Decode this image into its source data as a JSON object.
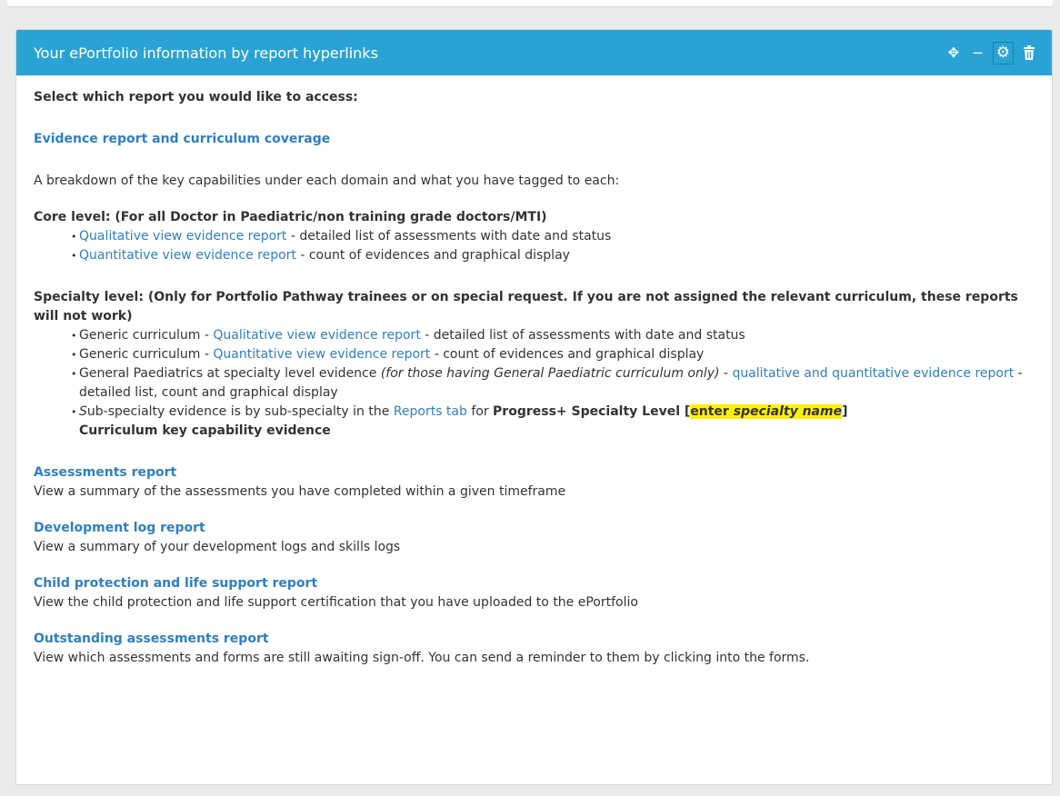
{
  "panel": {
    "title": "Your ePortfolio information by report hyperlinks",
    "tools": [
      {
        "name": "move",
        "glyph": "✥"
      },
      {
        "name": "minimize",
        "glyph": "−"
      },
      {
        "name": "settings",
        "glyph": "⚙"
      },
      {
        "name": "delete",
        "glyph": "🗑"
      }
    ]
  },
  "intro": "Select which report you would like to access:",
  "evidence": {
    "link": "Evidence report and curriculum coverage",
    "description": "A breakdown of the key capabilities under each domain and what you have tagged to each:",
    "core_heading": "Core level: (For all Doctor in Paediatric/non training grade doctors/MTI)",
    "core_items": [
      {
        "link": "Qualitative view evidence report",
        "rest": " - detailed list of assessments with date and status"
      },
      {
        "link": "Quantitative view evidence report",
        "rest": " - count of evidences and graphical display"
      }
    ],
    "specialty_heading": "Specialty level: (Only for Portfolio Pathway trainees or on special request. If you are not assigned the relevant curriculum, these reports will not work)",
    "specialty_items": [
      {
        "pre": "Generic curriculum - ",
        "link": "Qualitative view evidence report",
        "rest": " - detailed list of assessments with date and status"
      },
      {
        "pre": "Generic curriculum - ",
        "link": "Quantitative view evidence report",
        "rest": " - count of evidences and graphical display"
      }
    ],
    "gp_item": {
      "pre": "General Paediatrics at specialty level evidence ",
      "italic": "(for those having General Paediatric curriculum only)",
      "dash": " - ",
      "link": "qualitative and quantitative evidence report",
      "rest": " - detailed list, count and graphical display"
    },
    "sub_item": {
      "pre_italic": "S",
      "pre": "ub-specialty evidence is by sub-specialty in the ",
      "link": "Reports tab",
      "mid": " for ",
      "bold1": "Progress+ Specialty Level [",
      "hl_plain": "enter ",
      "hl_italic": "specialty name",
      "bold2": "]",
      "bold3": "Curriculum key capability evidence"
    }
  },
  "reports": [
    {
      "title": "Assessments report",
      "description": "View a summary of the assessments you have completed within a given timeframe"
    },
    {
      "title": "Development log report",
      "description": "View a summary of your development logs and skills logs"
    },
    {
      "title": "Child protection and life support report",
      "description": "View the child protection and life support certification that you have uploaded to the ePortfolio"
    },
    {
      "title": "Outstanding assessments report",
      "description": "View which assessments and forms are still awaiting sign-off. You can send a reminder to them by clicking into the forms."
    }
  ],
  "colors": {
    "header": "#2aa3d4",
    "link": "#2f7fc1",
    "highlight": "#fff200",
    "text": "#333333"
  }
}
